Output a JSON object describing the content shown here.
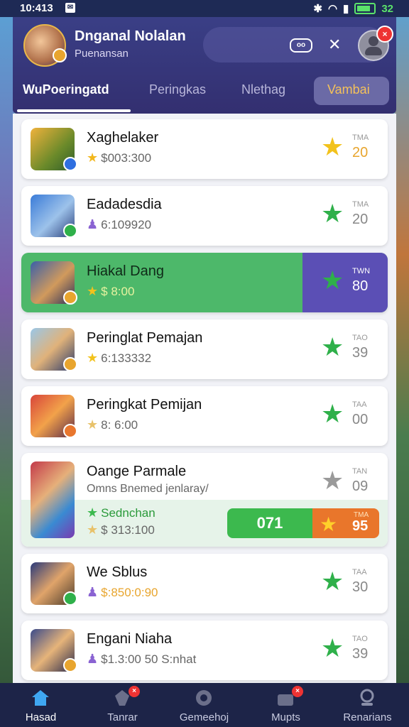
{
  "status_bar": {
    "time": "10:413",
    "notif_glyph": "✉",
    "battery_pct": "32"
  },
  "header": {
    "user_name": "Dnganal Nolalan",
    "user_sub": "Puenansan",
    "pill_icon": "vr-icon",
    "tool_icon": "tools-icon",
    "profile_badge": "×"
  },
  "tabs": [
    {
      "label": "WuPoeringatd",
      "active": true
    },
    {
      "label": "Peringkas"
    },
    {
      "label": "Nlethag"
    },
    {
      "label": "Vambai"
    }
  ],
  "list": [
    {
      "title": "Xaghelaker",
      "sub_icon": "star-icon",
      "sub": "$003:300",
      "star": "gold",
      "rank_label": "TMA",
      "rank_value": "20"
    },
    {
      "title": "Eadadesdia",
      "sub_icon": "person-icon",
      "sub": "6:109920",
      "star": "green",
      "rank_label": "TMA",
      "rank_value": "20"
    },
    {
      "title": "Hiakal Dang",
      "sub_icon": "star-icon",
      "sub": "$ 8:00",
      "star": "green",
      "rank_label": "TWN",
      "rank_value": "80",
      "highlight": true
    },
    {
      "title": "Peringlat Pemajan",
      "sub_icon": "star-icon",
      "sub": "6:133332",
      "star": "green",
      "rank_label": "TAO",
      "rank_value": "39"
    },
    {
      "title": "Peringkat Pemijan",
      "sub_icon": "star-icon",
      "sub": "8: 6:00",
      "star": "green",
      "rank_label": "TAA",
      "rank_value": "00"
    }
  ],
  "featured": {
    "title": "Oange Parmale",
    "desc": "Omns Bnemed jenlaray/",
    "tag": "Sednchan",
    "sub": "$ 313:100",
    "star": "gray",
    "rank_label": "TAN",
    "rank_value": "09",
    "btn_green": "071",
    "btn_orange_label": "TMA",
    "btn_orange_value": "95"
  },
  "list2": [
    {
      "title": "We Sblus",
      "sub_icon": "person-icon",
      "sub": "$:850:0:90",
      "star": "green",
      "rank_label": "TAA",
      "rank_value": "30"
    },
    {
      "title": "Engani Niaha",
      "sub_icon": "person-icon",
      "sub": "$1.3:00 50 S:nhat",
      "star": "green",
      "rank_label": "TAO",
      "rank_value": "39"
    }
  ],
  "nav": [
    {
      "label": "Hasad",
      "icon": "home-icon",
      "active": true
    },
    {
      "label": "Tanrar",
      "icon": "tag-icon",
      "badge": "×"
    },
    {
      "label": "Gemeehoj",
      "icon": "gamepad-icon"
    },
    {
      "label": "Mupts",
      "icon": "shop-icon",
      "badge": "×"
    },
    {
      "label": "Renarians",
      "icon": "profile-icon"
    }
  ],
  "colors": {
    "header_bg": "#363677",
    "highlight_green": "#4db86a",
    "highlight_purple": "#5b4fb5",
    "accent_orange": "#e9762b"
  }
}
